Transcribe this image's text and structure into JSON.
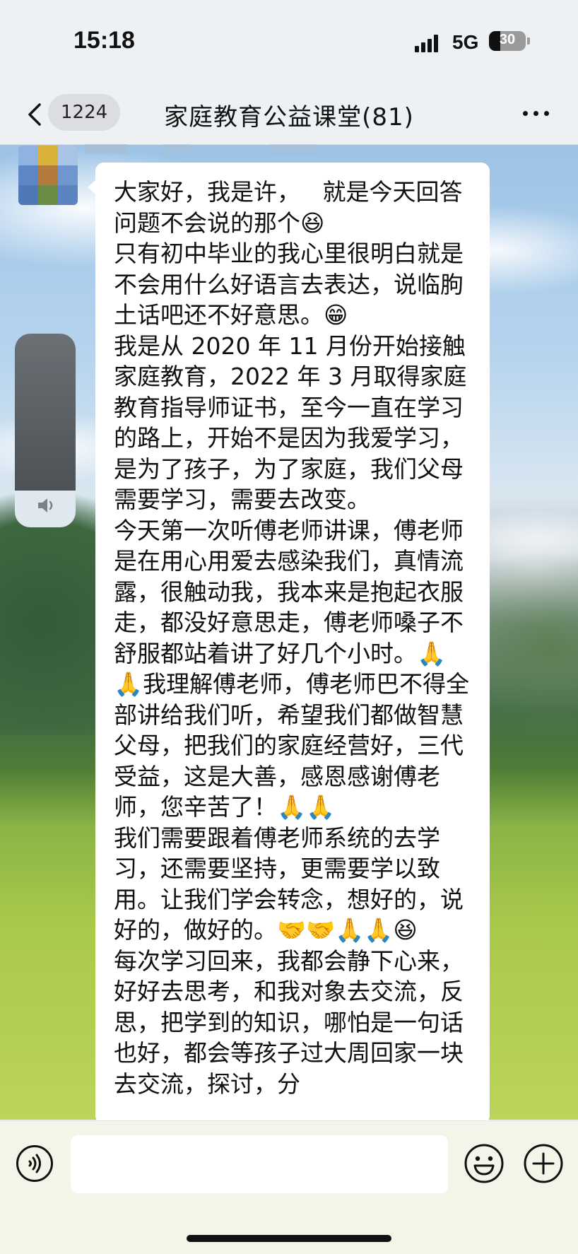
{
  "status_bar": {
    "time": "15:18",
    "network": "5G",
    "battery": "30",
    "battery_level_percent": 30
  },
  "nav": {
    "unread_badge": "1224",
    "title": "家庭教育公益课堂(81)"
  },
  "message": {
    "text": "大家好，我是许，   就是今天回答问题不会说的那个😆\n只有初中毕业的我心里很明白就是不会用什么好语言去表达，说临朐土话吧还不好意思。😁\n我是从 2020 年 11 月份开始接触家庭教育，2022 年 3 月取得家庭教育指导师证书，至今一直在学习的路上，开始不是因为我爱学习，是为了孩子，为了家庭，我们父母需要学习，需要去改变。\n今天第一次听傅老师讲课，傅老师是在用心用爱去感染我们，真情流露，很触动我，我本来是抱起衣服走，都没好意思走，傅老师嗓子不舒服都站着讲了好几个小时。🙏🙏我理解傅老师，傅老师巴不得全部讲给我们听，希望我们都做智慧父母，把我们的家庭经营好，三代受益，这是大善，感恩感谢傅老师，您辛苦了！🙏🙏\n我们需要跟着傅老师系统的去学习，还需要坚持，更需要学以致用。让我们学会转念，想好的，说好的，做好的。🤝🤝🙏🙏😆\n每次学习回来，我都会静下心来，好好去思考，和我对象去交流，反思，把学到的知识，哪怕是一句话也好，都会等孩子过大周回家一块去交流，探讨，分"
  },
  "input": {
    "value": "",
    "placeholder": ""
  },
  "volume": {
    "level_percent": 19
  },
  "icons": {
    "back": "chevron-left-icon",
    "more": "more-dots-icon",
    "speaker": "speaker-icon",
    "voice": "voice-icon",
    "emoji": "emoji-icon",
    "plus": "plus-icon"
  }
}
